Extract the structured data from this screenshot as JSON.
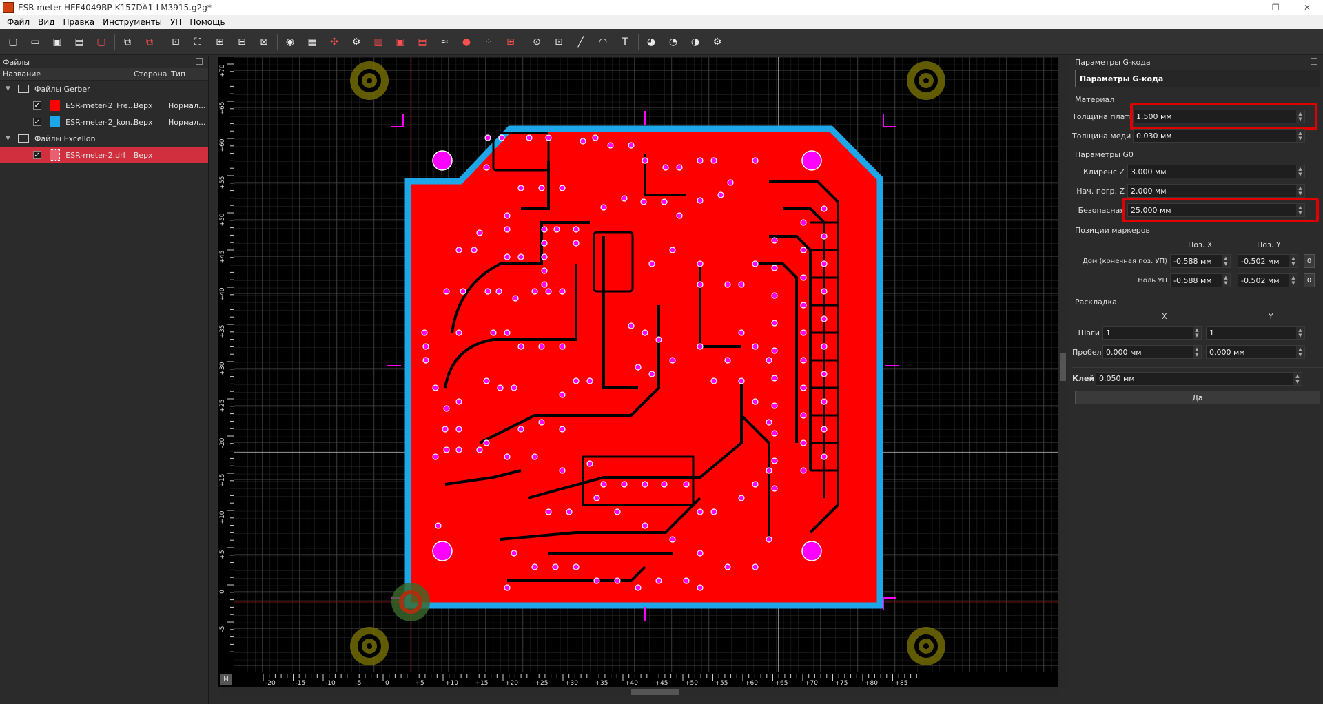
{
  "window": {
    "title": "ESR-meter-HEF4049BP-K157DA1-LM3915.g2g*",
    "minimize": "–",
    "maximize": "❐",
    "close": "✕"
  },
  "menu": [
    "Файл",
    "Вид",
    "Правка",
    "Инструменты",
    "УП",
    "Помощь"
  ],
  "toolbar_icons": [
    "new-icon",
    "open-icon",
    "save-icon",
    "save-as-icon",
    "close-file-icon",
    "import-icon",
    "export-icon",
    "select-all-icon",
    "fit-icon",
    "zoom-in-icon",
    "zoom-out-icon",
    "layers-icon",
    "gcode-icon",
    "settings-icon",
    "marker-icon",
    "drill-icon",
    "thermal-icon",
    "pocket-icon",
    "profile-icon",
    "voronoi-icon",
    "hatching-icon",
    "circle-target-icon",
    "center-icon",
    "origin-icon",
    "point-icon",
    "rect-icon",
    "line-icon",
    "arc-icon",
    "text-icon",
    "shape1-icon",
    "shape2-icon",
    "shape3-icon",
    "shape4-icon"
  ],
  "files_panel": {
    "title": "Файлы",
    "columns": {
      "name": "Название",
      "side": "Сторона",
      "type": "Тип"
    },
    "groups": [
      {
        "label": "Файлы Gerber",
        "items": [
          {
            "name": "ESR-meter-2_Fre...",
            "side": "Верх",
            "type": "Нормал...",
            "color": "#ff0000"
          },
          {
            "name": "ESR-meter-2_kon...",
            "side": "Верх",
            "type": "Нормал...",
            "color": "#1ea7e8"
          }
        ]
      },
      {
        "label": "Файлы Excellon",
        "items": [
          {
            "name": "ESR-meter-2.drl",
            "side": "Верх",
            "type": "",
            "color": "#d12f3e"
          }
        ]
      }
    ]
  },
  "rulers": {
    "y_ticks": [
      "+70",
      "+65",
      "+60",
      "+55",
      "+50",
      "+45",
      "+40",
      "+35",
      "+30",
      "+25",
      "-20",
      "+15",
      "+10",
      "+5",
      "0",
      "-5"
    ],
    "x_ticks": [
      "-20",
      "-15",
      "-10",
      "-5",
      "0",
      "+5",
      "+10",
      "+15",
      "+20",
      "+25",
      "+30",
      "+35",
      "+40",
      "+45",
      "+50",
      "+55",
      "+60",
      "+65",
      "+70",
      "+75",
      "+80",
      "+85"
    ],
    "corner": "M"
  },
  "gcode_panel": {
    "header": "Параметры G-кода",
    "title": "Параметры G-кода",
    "material": {
      "section": "Материал",
      "board_thickness_label": "Толщина платы",
      "board_thickness": "1.500 мм",
      "copper_thickness_label": "Толщина меди",
      "copper_thickness": "0.030 мм"
    },
    "g0": {
      "section": "Параметры G0",
      "clearance_z_label": "Клиренс Z",
      "clearance_z": "3.000 мм",
      "plunge_z_label": "Нач. погр. Z",
      "plunge_z": "2.000 мм",
      "safe_label": "Безопасная",
      "safe": "25.000 мм"
    },
    "markers": {
      "section": "Позиции маркеров",
      "col_x": "Поз. X",
      "col_y": "Поз. Y",
      "home_label": "Дом (конечная поз. УП)",
      "home_x": "-0.588 мм",
      "home_y": "-0.502 мм",
      "zero_label": "Ноль УП",
      "zero_x": "-0.588 мм",
      "zero_y": "-0.502 мм",
      "btn": "0"
    },
    "layout": {
      "section": "Раскладка",
      "col_x": "X",
      "col_y": "Y",
      "steps_label": "Шаги",
      "steps_x": "1",
      "steps_y": "1",
      "gap_label": "Пробел",
      "gap_x": "0.000 мм",
      "gap_y": "0.000 мм"
    },
    "glue_label": "Клей",
    "glue": "0.050 мм",
    "ok": "Да"
  },
  "colors": {
    "copper": "#ff0000",
    "outline": "#1ea7e8",
    "drill": "#ff00ff",
    "highlight": "#e00000"
  }
}
